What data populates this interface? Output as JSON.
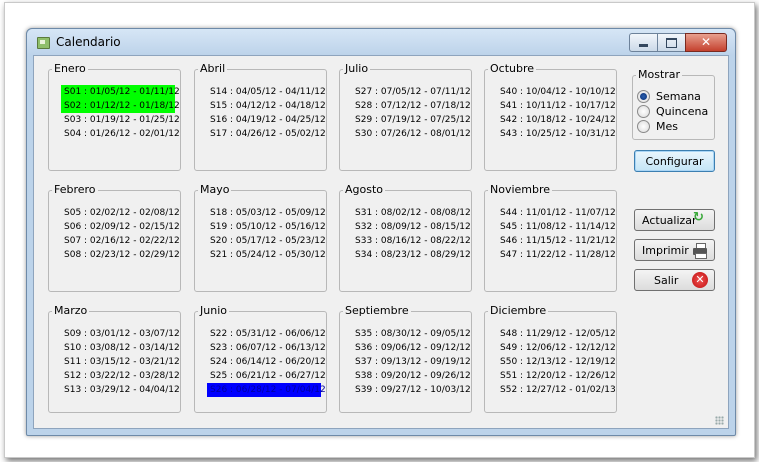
{
  "window": {
    "title": "Calendario"
  },
  "months": [
    {
      "name": "Enero",
      "weeks": [
        "S01 : 01/05/12 - 01/11/12",
        "S02 : 01/12/12 - 01/18/12",
        "S03 : 01/19/12 - 01/25/12",
        "S04 : 01/26/12 - 02/01/12"
      ]
    },
    {
      "name": "Abril",
      "weeks": [
        "S14 : 04/05/12 - 04/11/12",
        "S15 : 04/12/12 - 04/18/12",
        "S16 : 04/19/12 - 04/25/12",
        "S17 : 04/26/12 - 05/02/12"
      ]
    },
    {
      "name": "Julio",
      "weeks": [
        "S27 : 07/05/12 - 07/11/12",
        "S28 : 07/12/12 - 07/18/12",
        "S29 : 07/19/12 - 07/25/12",
        "S30 : 07/26/12 - 08/01/12"
      ]
    },
    {
      "name": "Octubre",
      "weeks": [
        "S40 : 10/04/12 - 10/10/12",
        "S41 : 10/11/12 - 10/17/12",
        "S42 : 10/18/12 - 10/24/12",
        "S43 : 10/25/12 - 10/31/12"
      ]
    },
    {
      "name": "Febrero",
      "weeks": [
        "S05 : 02/02/12 - 02/08/12",
        "S06 : 02/09/12 - 02/15/12",
        "S07 : 02/16/12 - 02/22/12",
        "S08 : 02/23/12 - 02/29/12"
      ]
    },
    {
      "name": "Mayo",
      "weeks": [
        "S18 : 05/03/12 - 05/09/12",
        "S19 : 05/10/12 - 05/16/12",
        "S20 : 05/17/12 - 05/23/12",
        "S21 : 05/24/12 - 05/30/12"
      ]
    },
    {
      "name": "Agosto",
      "weeks": [
        "S31 : 08/02/12 - 08/08/12",
        "S32 : 08/09/12 - 08/15/12",
        "S33 : 08/16/12 - 08/22/12",
        "S34 : 08/23/12 - 08/29/12"
      ]
    },
    {
      "name": "Noviembre",
      "weeks": [
        "S44 : 11/01/12 - 11/07/12",
        "S45 : 11/08/12 - 11/14/12",
        "S46 : 11/15/12 - 11/21/12",
        "S47 : 11/22/12 - 11/28/12"
      ]
    },
    {
      "name": "Marzo",
      "weeks": [
        "S09 : 03/01/12 - 03/07/12",
        "S10 : 03/08/12 - 03/14/12",
        "S11 : 03/15/12 - 03/21/12",
        "S12 : 03/22/12 - 03/28/12",
        "S13 : 03/29/12 - 04/04/12"
      ]
    },
    {
      "name": "Junio",
      "weeks": [
        "S22 : 05/31/12 - 06/06/12",
        "S23 : 06/07/12 - 06/13/12",
        "S24 : 06/14/12 - 06/20/12",
        "S25 : 06/21/12 - 06/27/12",
        "S26 : 06/28/12 - 07/04/12"
      ]
    },
    {
      "name": "Septiembre",
      "weeks": [
        "S35 : 08/30/12 - 09/05/12",
        "S36 : 09/06/12 - 09/12/12",
        "S37 : 09/13/12 - 09/19/12",
        "S38 : 09/20/12 - 09/26/12",
        "S39 : 09/27/12 - 10/03/12"
      ]
    },
    {
      "name": "Diciembre",
      "weeks": [
        "S48 : 11/29/12 - 12/05/12",
        "S49 : 12/06/12 - 12/12/12",
        "S50 : 12/13/12 - 12/19/12",
        "S51 : 12/20/12 - 12/26/12",
        "S52 : 12/27/12 - 01/02/13"
      ]
    }
  ],
  "mostrar": {
    "label": "Mostrar",
    "options": [
      "Semana",
      "Quincena",
      "Mes"
    ],
    "selected": "Semana"
  },
  "buttons": {
    "configurar": "Configurar",
    "actualizar": "Actualizar",
    "imprimir": "Imprimir",
    "salir": "Salir"
  },
  "colors": {
    "highlight_green": "#00ff00",
    "highlight_blue": "#0000ff"
  }
}
